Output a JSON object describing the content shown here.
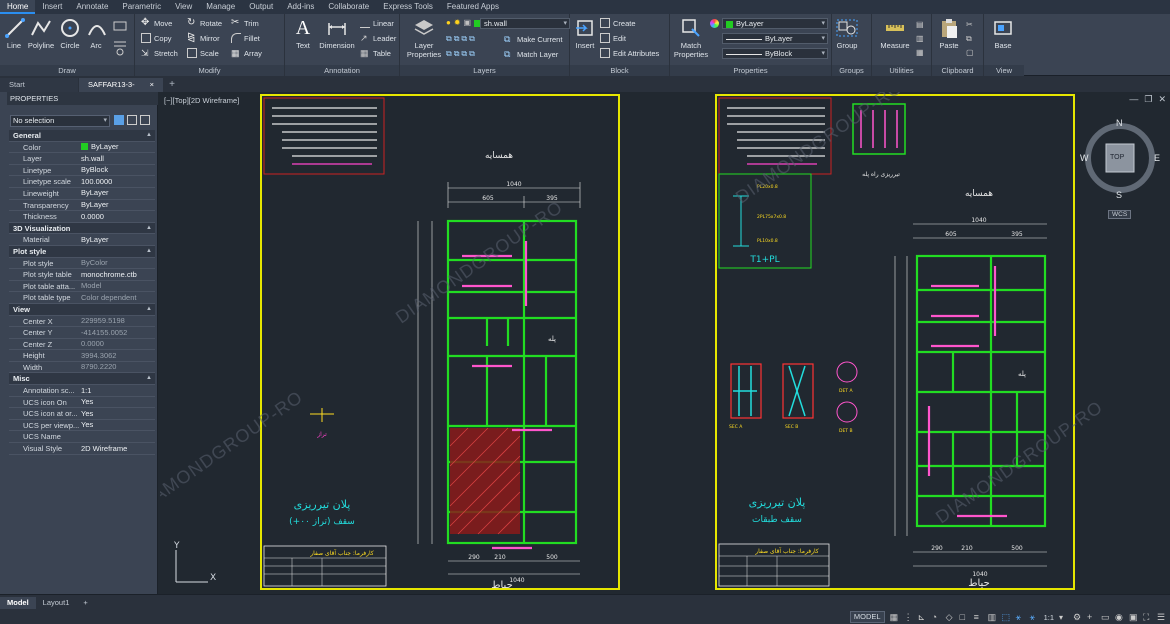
{
  "ribbon_tabs": [
    "Home",
    "Insert",
    "Annotate",
    "Parametric",
    "View",
    "Manage",
    "Output",
    "Add-ins",
    "Collaborate",
    "Express Tools",
    "Featured Apps"
  ],
  "active_tab": "Home",
  "draw_panel": {
    "label": "Draw",
    "tools": [
      "Line",
      "Polyline",
      "Circle",
      "Arc"
    ]
  },
  "modify_panel": {
    "label": "Modify",
    "tools": [
      "Move",
      "Rotate",
      "Trim",
      "Copy",
      "Mirror",
      "Fillet",
      "Stretch",
      "Scale",
      "Array"
    ]
  },
  "annotation_panel": {
    "label": "Annotation",
    "tools": [
      "Text",
      "Dimension",
      "Linear",
      "Leader",
      "Table"
    ]
  },
  "layers_panel": {
    "label": "Layers",
    "layer_properties": "Layer Properties",
    "current_layer": "sh.wall",
    "make_current": "Make Current",
    "match_layer": "Match Layer"
  },
  "block_panel": {
    "label": "Block",
    "insert": "Insert",
    "create": "Create",
    "edit": "Edit",
    "edit_attributes": "Edit Attributes"
  },
  "properties_panel": {
    "label": "Properties",
    "match": "Match Properties",
    "color": "ByLayer",
    "linetype": "ByLayer",
    "lineweight": "ByBlock"
  },
  "groups_panel": {
    "label": "Groups",
    "group": "Group"
  },
  "utilities_panel": {
    "label": "Utilities",
    "measure": "Measure"
  },
  "clipboard_panel": {
    "label": "Clipboard",
    "paste": "Paste"
  },
  "view_panel": {
    "label": "View",
    "base": "Base"
  },
  "file_tabs": [
    {
      "label": "Start",
      "active": false
    },
    {
      "label": "SAFFAR13-3-97(1)*",
      "active": true
    }
  ],
  "palette": {
    "title": "PROPERTIES",
    "selection": "No selection",
    "sections": [
      {
        "name": "General",
        "rows": [
          {
            "k": "Color",
            "v": "ByLayer",
            "swatch": "#22cc22"
          },
          {
            "k": "Layer",
            "v": "sh.wall"
          },
          {
            "k": "Linetype",
            "v": "ByBlock"
          },
          {
            "k": "Linetype scale",
            "v": "100.0000"
          },
          {
            "k": "Lineweight",
            "v": "ByLayer"
          },
          {
            "k": "Transparency",
            "v": "ByLayer"
          },
          {
            "k": "Thickness",
            "v": "0.0000"
          }
        ]
      },
      {
        "name": "3D Visualization",
        "rows": [
          {
            "k": "Material",
            "v": "ByLayer"
          }
        ]
      },
      {
        "name": "Plot style",
        "rows": [
          {
            "k": "Plot style",
            "v": "ByColor",
            "dim": true
          },
          {
            "k": "Plot style table",
            "v": "monochrome.ctb"
          },
          {
            "k": "Plot table atta...",
            "v": "Model",
            "dim": true
          },
          {
            "k": "Plot table type",
            "v": "Color dependent",
            "dim": true
          }
        ]
      },
      {
        "name": "View",
        "rows": [
          {
            "k": "Center X",
            "v": "229959.5198",
            "dim": true
          },
          {
            "k": "Center Y",
            "v": "-414155.0052",
            "dim": true
          },
          {
            "k": "Center Z",
            "v": "0.0000",
            "dim": true
          },
          {
            "k": "Height",
            "v": "3994.3062",
            "dim": true
          },
          {
            "k": "Width",
            "v": "8790.2220",
            "dim": true
          }
        ]
      },
      {
        "name": "Misc",
        "rows": [
          {
            "k": "Annotation sc...",
            "v": "1:1"
          },
          {
            "k": "UCS icon On",
            "v": "Yes"
          },
          {
            "k": "UCS icon at or...",
            "v": "Yes"
          },
          {
            "k": "UCS per viewp...",
            "v": "Yes"
          },
          {
            "k": "UCS Name",
            "v": ""
          },
          {
            "k": "Visual Style",
            "v": "2D Wireframe"
          }
        ]
      }
    ]
  },
  "viewport_label": "[−][Top][2D Wireframe]",
  "viewcube": {
    "n": "N",
    "s": "S",
    "e": "E",
    "w": "W",
    "top": "TOP",
    "wcs": "WCS"
  },
  "drawing": {
    "left_sheet": {
      "title_top": "همسایه",
      "title_bottom": "حیاط",
      "plan_title": "پلان تیرریزی",
      "plan_sub": "سقف (تراز ۰۰+)",
      "dims": [
        "1040",
        "605",
        "395",
        "290",
        "210",
        "500"
      ]
    },
    "right_sheet": {
      "title_top": "همسایه",
      "title_bottom": "حیاط",
      "plan_title": "پلان تیرریزی",
      "plan_sub": "سقف طبقات",
      "detail_label": "T1+PL",
      "tirrizi": "تیرریزی راه پله",
      "dims": [
        "1040",
        "605",
        "395",
        "290",
        "210",
        "500"
      ]
    },
    "watermark": "DIAMONDGROUP-RO"
  },
  "layout_tabs": [
    {
      "label": "Model",
      "active": true
    },
    {
      "label": "Layout1",
      "active": false
    }
  ],
  "status": {
    "model": "MODEL",
    "scale": "1:1"
  }
}
